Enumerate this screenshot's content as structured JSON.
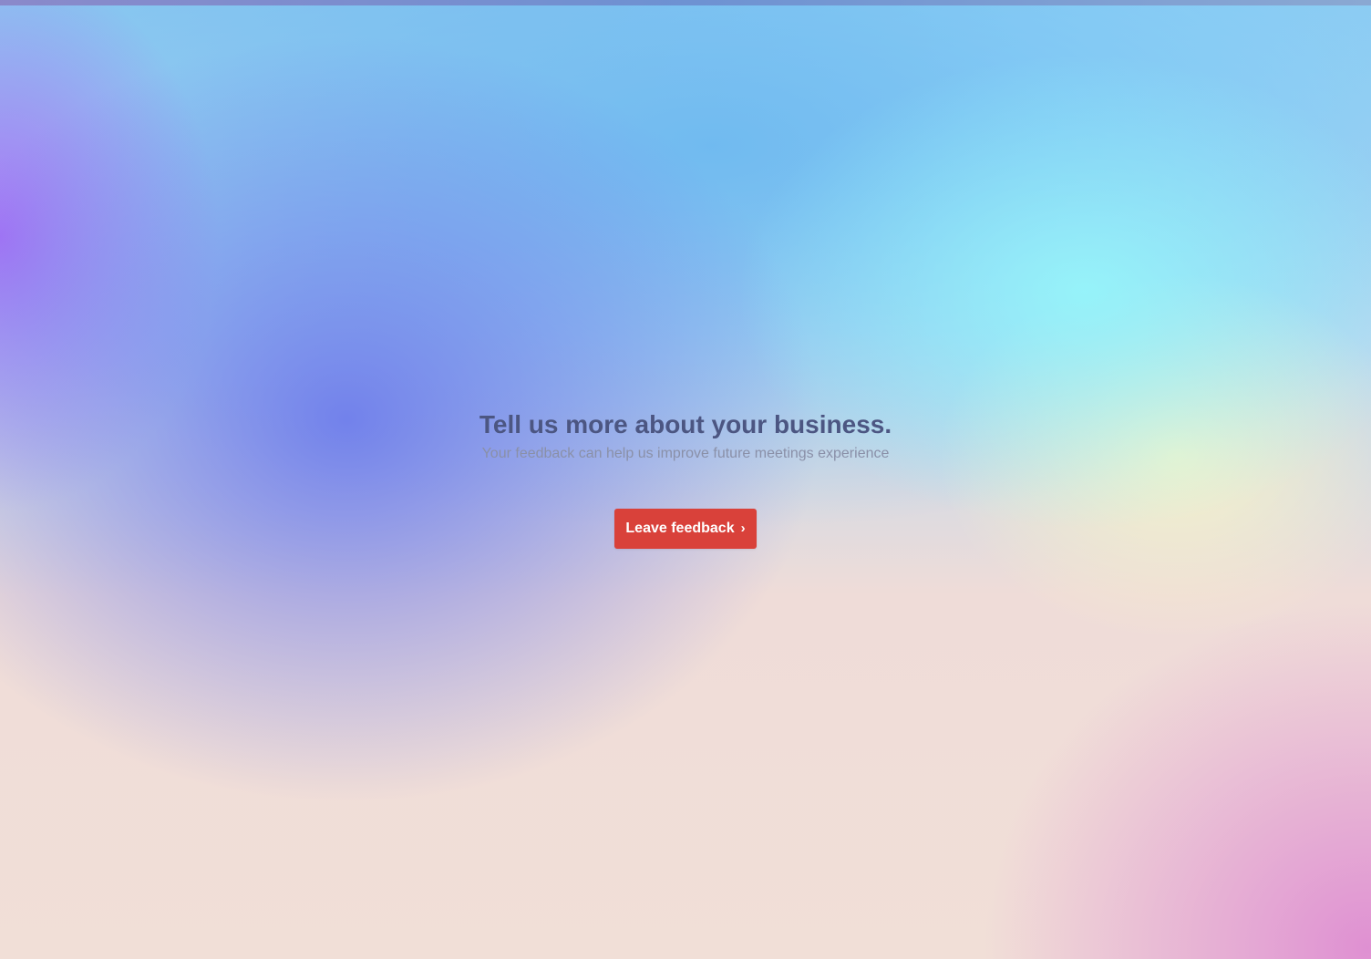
{
  "page": {
    "headline": "Tell us more about your business.",
    "subheadline": "Your feedback can help us improve future meetings experience"
  },
  "feedback_button": {
    "label": "Leave feedback",
    "icon": "chevron-right-icon",
    "color": "#d9413a"
  },
  "colors": {
    "headline": "#4c5682",
    "subheadline": "#8a90a8"
  }
}
